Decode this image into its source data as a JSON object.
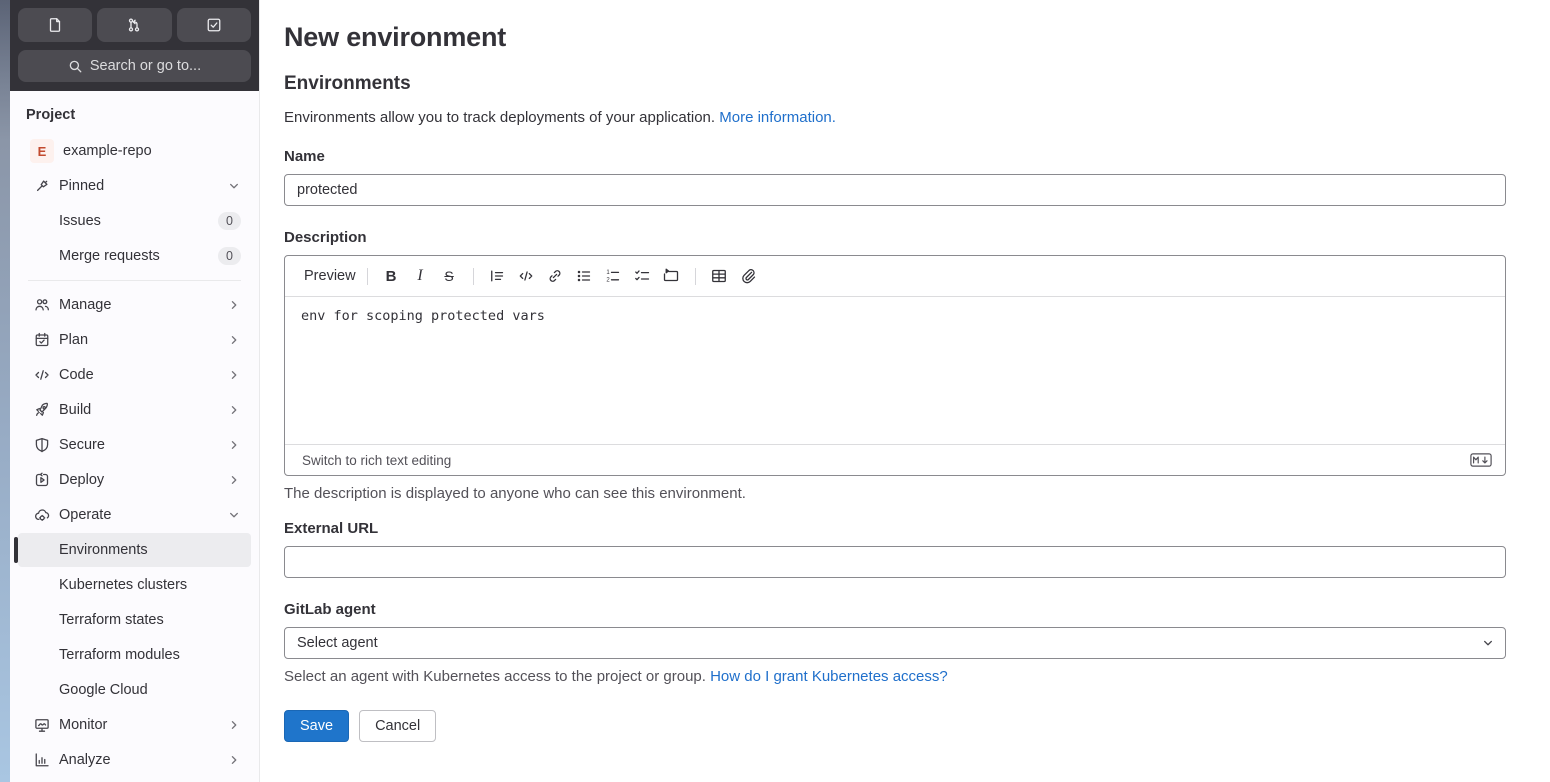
{
  "app": {
    "accent_color": "#1f75cb",
    "link_color": "#1f6fcb"
  },
  "sidebar": {
    "shortcuts": [
      {
        "name": "issues-shortcut",
        "icon": "document-icon"
      },
      {
        "name": "merge-requests-shortcut",
        "icon": "merge-request-icon"
      },
      {
        "name": "todo-shortcut",
        "icon": "task-done-icon"
      }
    ],
    "search_label": "Search or go to...",
    "section_label": "Project",
    "project": {
      "avatar_letter": "E",
      "name": "example-repo"
    },
    "pinned": {
      "label": "Pinned",
      "items": [
        {
          "label": "Issues",
          "badge": "0"
        },
        {
          "label": "Merge requests",
          "badge": "0"
        }
      ]
    },
    "nav": [
      {
        "label": "Manage",
        "icon": "users-icon"
      },
      {
        "label": "Plan",
        "icon": "calendar-check-icon"
      },
      {
        "label": "Code",
        "icon": "code-icon"
      },
      {
        "label": "Build",
        "icon": "rocket-icon"
      },
      {
        "label": "Secure",
        "icon": "shield-icon"
      },
      {
        "label": "Deploy",
        "icon": "deployments-icon"
      },
      {
        "label": "Operate",
        "icon": "cloud-gear-icon",
        "expanded": true
      },
      {
        "label": "Monitor",
        "icon": "monitor-icon"
      },
      {
        "label": "Analyze",
        "icon": "chart-icon"
      }
    ],
    "operate_children": [
      {
        "label": "Environments",
        "active": true
      },
      {
        "label": "Kubernetes clusters"
      },
      {
        "label": "Terraform states"
      },
      {
        "label": "Terraform modules"
      },
      {
        "label": "Google Cloud"
      }
    ]
  },
  "main": {
    "page_title": "New environment",
    "section_heading": "Environments",
    "intro": {
      "text": "Environments allow you to track deployments of your application.",
      "link_label": "More information."
    },
    "name_field": {
      "label": "Name",
      "value": "protected"
    },
    "description": {
      "label": "Description",
      "toolbar": {
        "preview_label": "Preview",
        "icons": [
          "bold",
          "italic",
          "strikethrough",
          "quote",
          "code",
          "link",
          "bullet-list",
          "numbered-list",
          "task-list",
          "collapsible-section",
          "table",
          "attach-file"
        ]
      },
      "value": "env for scoping protected vars",
      "switch_mode_label": "Switch to rich text editing",
      "markdown_badge": "markdown-supported",
      "help": "The description is displayed to anyone who can see this environment."
    },
    "external_url_field": {
      "label": "External URL",
      "value": ""
    },
    "agent_field": {
      "label": "GitLab agent",
      "selected": "Select agent",
      "help": "Select an agent with Kubernetes access to the project or group.",
      "help_link": "How do I grant Kubernetes access?"
    },
    "actions": {
      "save_label": "Save",
      "cancel_label": "Cancel"
    }
  }
}
